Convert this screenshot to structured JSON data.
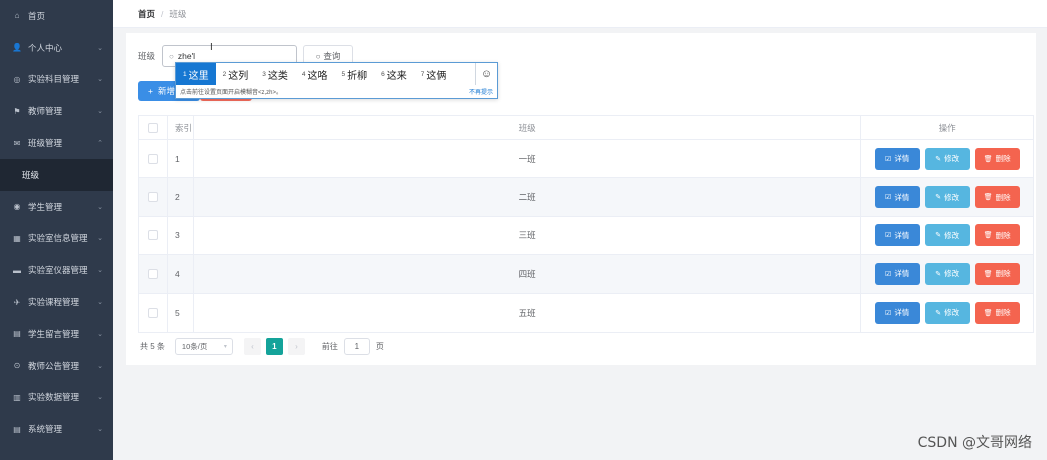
{
  "sidebar": {
    "items": [
      {
        "icon": "home-icon",
        "glyph": "⌂",
        "label": "首页",
        "chevron": ""
      },
      {
        "icon": "user-icon",
        "glyph": "👤",
        "label": "个人中心",
        "chevron": "⌄"
      },
      {
        "icon": "globe-icon",
        "glyph": "◎",
        "label": "实验科目管理",
        "chevron": "⌄"
      },
      {
        "icon": "flag-icon",
        "glyph": "⚑",
        "label": "教师管理",
        "chevron": "⌄"
      },
      {
        "icon": "mail-icon",
        "glyph": "✉",
        "label": "班级管理",
        "chevron": "⌃"
      },
      {
        "icon": "",
        "glyph": "",
        "label": "班级",
        "chevron": "",
        "sub": true
      },
      {
        "icon": "mic-icon",
        "glyph": "◉",
        "label": "学生管理",
        "chevron": "⌄"
      },
      {
        "icon": "bar-chart-icon",
        "glyph": "▦",
        "label": "实验室信息管理",
        "chevron": "⌄"
      },
      {
        "icon": "truck-icon",
        "glyph": "▬",
        "label": "实验室仪器管理",
        "chevron": "⌄"
      },
      {
        "icon": "send-icon",
        "glyph": "✈",
        "label": "实验课程管理",
        "chevron": "⌄"
      },
      {
        "icon": "message-icon",
        "glyph": "▤",
        "label": "学生留言管理",
        "chevron": "⌄"
      },
      {
        "icon": "compass-icon",
        "glyph": "⊙",
        "label": "教师公告管理",
        "chevron": "⌄"
      },
      {
        "icon": "clipboard-icon",
        "glyph": "▥",
        "label": "实验数据管理",
        "chevron": "⌄"
      },
      {
        "icon": "document-icon",
        "glyph": "▤",
        "label": "系统管理",
        "chevron": "⌄"
      }
    ]
  },
  "breadcrumb": {
    "home": "首页",
    "separator": "/",
    "current": "班级"
  },
  "search": {
    "label": "班级",
    "value": "zhe'l",
    "button": "查询",
    "search_icon": "○"
  },
  "actions": {
    "add_label": "新增",
    "add_icon": "+"
  },
  "ime": {
    "candidates": [
      {
        "num": "1",
        "text": "这里"
      },
      {
        "num": "2",
        "text": "这列"
      },
      {
        "num": "3",
        "text": "这类"
      },
      {
        "num": "4",
        "text": "这咯"
      },
      {
        "num": "5",
        "text": "折柳"
      },
      {
        "num": "6",
        "text": "这来"
      },
      {
        "num": "7",
        "text": "这俩"
      }
    ],
    "emoji": "☺",
    "tip": "点击前往设置页面开启模糊音<z,zh>。",
    "dismiss": "不再提示"
  },
  "table": {
    "headers": {
      "index": "索引",
      "class": "班级",
      "ops": "操作"
    },
    "rows": [
      {
        "index": "1",
        "class": "一班"
      },
      {
        "index": "2",
        "class": "二班"
      },
      {
        "index": "3",
        "class": "三班"
      },
      {
        "index": "4",
        "class": "四班"
      },
      {
        "index": "5",
        "class": "五班"
      }
    ],
    "op_labels": {
      "detail": "详情",
      "edit": "修改",
      "delete": "删除"
    },
    "op_icons": {
      "detail": "☑",
      "edit": "✎",
      "delete": "🗑"
    }
  },
  "pagination": {
    "total": "共 5 条",
    "page_size": "10条/页",
    "prev": "‹",
    "next": "›",
    "current": "1",
    "goto_label": "前往",
    "goto_value": "1",
    "page_suffix": "页"
  },
  "watermark": "CSDN @文哥网络",
  "colors": {
    "sidebar_bg": "#2f3a4b",
    "primary": "#3a8ee6",
    "danger": "#f56c5c",
    "pager_active": "#14a39a"
  }
}
